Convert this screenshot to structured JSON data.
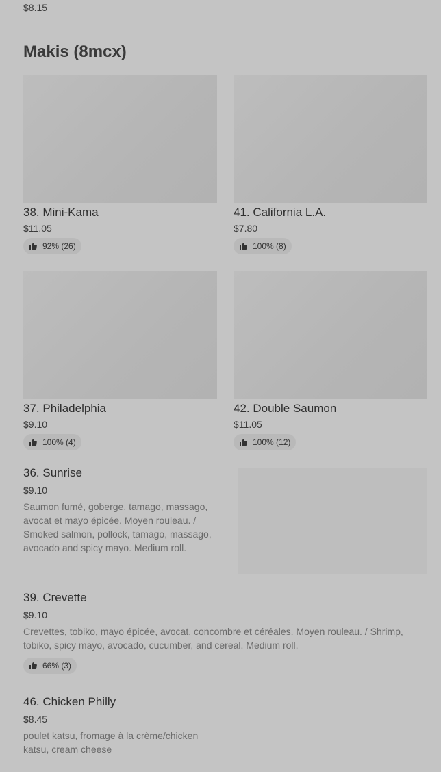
{
  "top_price": "$8.15",
  "section": {
    "title": "Makis (8mcx)"
  },
  "cards": [
    {
      "name": "38. Mini-Kama",
      "price": "$11.05",
      "rating": "92% (26)"
    },
    {
      "name": "41. California L.A.",
      "price": "$7.80",
      "rating": "100% (8)"
    },
    {
      "name": "37. Philadelphia",
      "price": "$9.10",
      "rating": "100% (4)"
    },
    {
      "name": "42. Double Saumon",
      "price": "$11.05",
      "rating": "100% (12)"
    }
  ],
  "list_items": [
    {
      "name": "36. Sunrise",
      "price": "$9.10",
      "description": "Saumon fumé, goberge, tamago, massago, avocat et mayo épicée. Moyen rouleau. / Smoked salmon, pollock, tamago, massago, avocado and spicy mayo. Medium roll."
    },
    {
      "name": "39. Crevette",
      "price": "$9.10",
      "description": "Crevettes, tobiko, mayo épicée, avocat, concombre et céréales. Moyen rouleau. / Shrimp, tobiko, spicy mayo, avocado, cucumber, and cereal. Medium roll.",
      "rating": "66% (3)"
    },
    {
      "name": "46. Chicken Philly",
      "price": "$8.45",
      "description": "poulet katsu, fromage à la crème/chicken katsu, cream cheese"
    }
  ],
  "icons": {
    "rating": "thumbs-up-icon"
  }
}
